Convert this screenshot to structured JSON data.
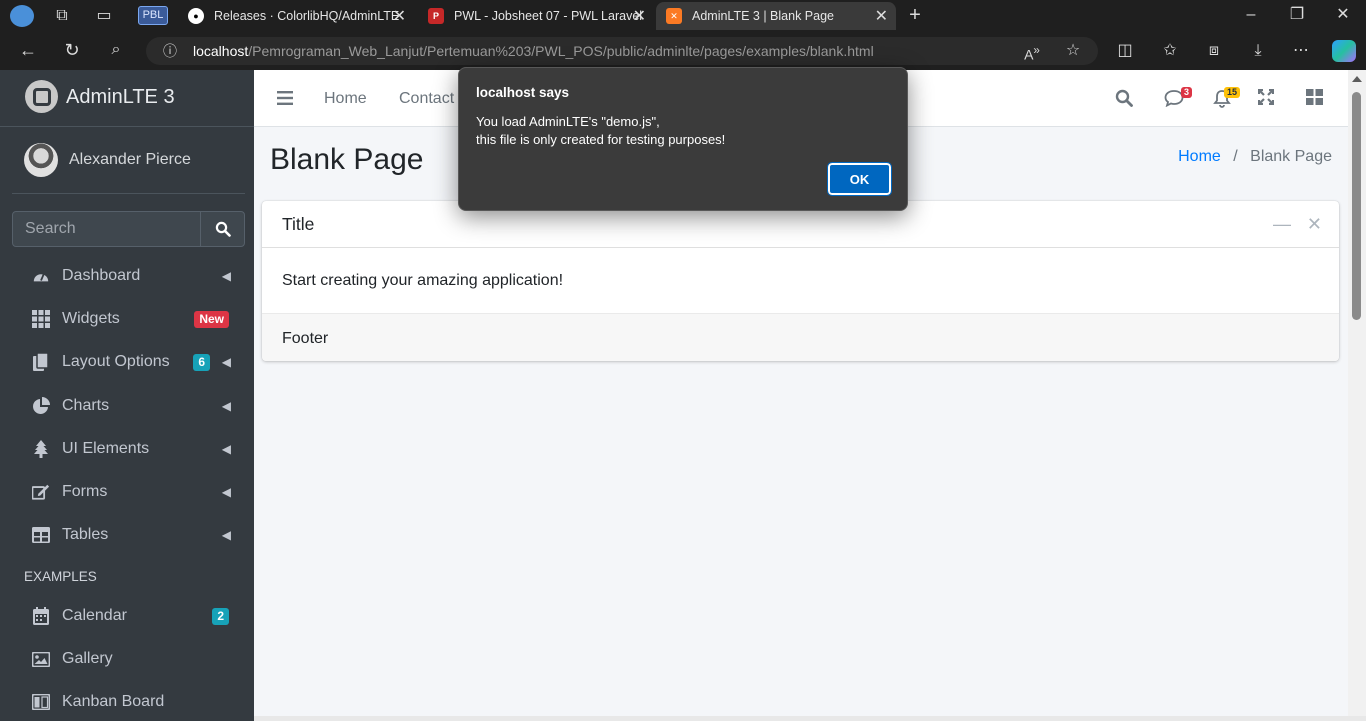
{
  "browser": {
    "profile_label": "PBL",
    "tabs": [
      {
        "title": "Releases · ColorlibHQ/AdminLTE",
        "favicon": "github-icon",
        "active": false
      },
      {
        "title": "PWL - Jobsheet 07 - PWL Laravel",
        "favicon": "pdf-icon",
        "active": false
      },
      {
        "title": "AdminLTE 3 | Blank Page",
        "favicon": "xampp-icon",
        "active": true
      }
    ],
    "url_host": "localhost",
    "url_path": "/Pemrograman_Web_Lanjut/Pertemuan%203/PWL_POS/public/adminlte/pages/examples/blank.html"
  },
  "sidebar": {
    "brand": "AdminLTE 3",
    "user_name": "Alexander Pierce",
    "search_placeholder": "Search",
    "items": [
      {
        "label": "Dashboard",
        "icon": "dashboard-icon",
        "caret": true
      },
      {
        "label": "Widgets",
        "icon": "widgets-icon",
        "badge": "New",
        "badge_color": "#dc3545"
      },
      {
        "label": "Layout Options",
        "icon": "copy-icon",
        "badge": "6",
        "badge_color": "#17a2b8",
        "caret": true
      },
      {
        "label": "Charts",
        "icon": "chart-pie-icon",
        "caret": true
      },
      {
        "label": "UI Elements",
        "icon": "tree-icon",
        "caret": true
      },
      {
        "label": "Forms",
        "icon": "edit-icon",
        "caret": true
      },
      {
        "label": "Tables",
        "icon": "table-icon",
        "caret": true
      }
    ],
    "section_header": "EXAMPLES",
    "examples": [
      {
        "label": "Calendar",
        "icon": "calendar-icon",
        "badge": "2",
        "badge_color": "#17a2b8"
      },
      {
        "label": "Gallery",
        "icon": "image-icon"
      },
      {
        "label": "Kanban Board",
        "icon": "columns-icon"
      }
    ]
  },
  "topnav": {
    "links": [
      "Home",
      "Contact"
    ],
    "messages_count": "3",
    "notifications_count": "15"
  },
  "content": {
    "page_title": "Blank Page",
    "breadcrumb_home": "Home",
    "breadcrumb_separator": "/",
    "breadcrumb_current": "Blank Page",
    "card_title": "Title",
    "card_body": "Start creating your amazing application!",
    "card_footer": "Footer"
  },
  "dialog": {
    "title": "localhost says",
    "message_line1": "You load AdminLTE's \"demo.js\",",
    "message_line2": "this file is only created for testing purposes!",
    "ok_label": "OK"
  }
}
